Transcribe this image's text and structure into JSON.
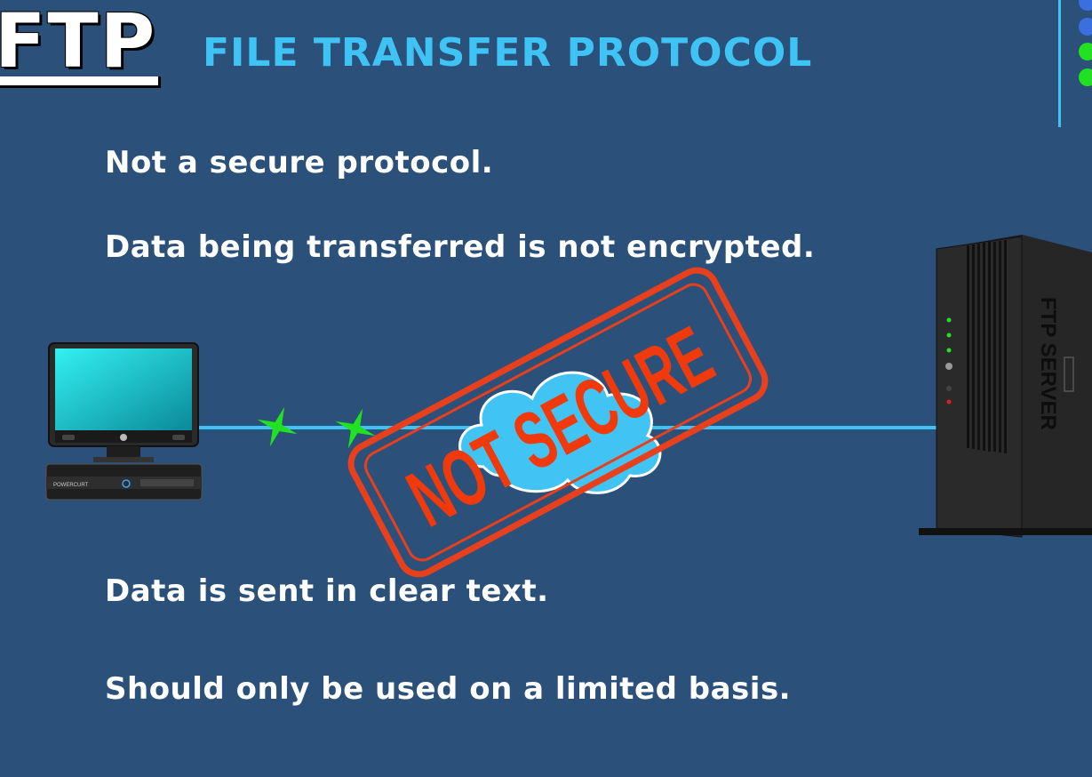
{
  "header": {
    "logo_text": "FTP",
    "title": "FILE TRANSFER PROTOCOL"
  },
  "bullets": [
    "Not a secure protocol.",
    "Data being transferred is not encrypted.",
    "Data is sent in clear text.",
    "Should only be used on a limited basis."
  ],
  "diagram": {
    "stamp_text": "NOT SECURE",
    "server_label": "FTP SERVER",
    "computer_brand": "POWERCURT"
  },
  "colors": {
    "background": "#2b5079",
    "accent": "#3fc3f5",
    "stamp": "#e8401c",
    "marker": "#22e022",
    "cloud": "#41c4f3"
  }
}
